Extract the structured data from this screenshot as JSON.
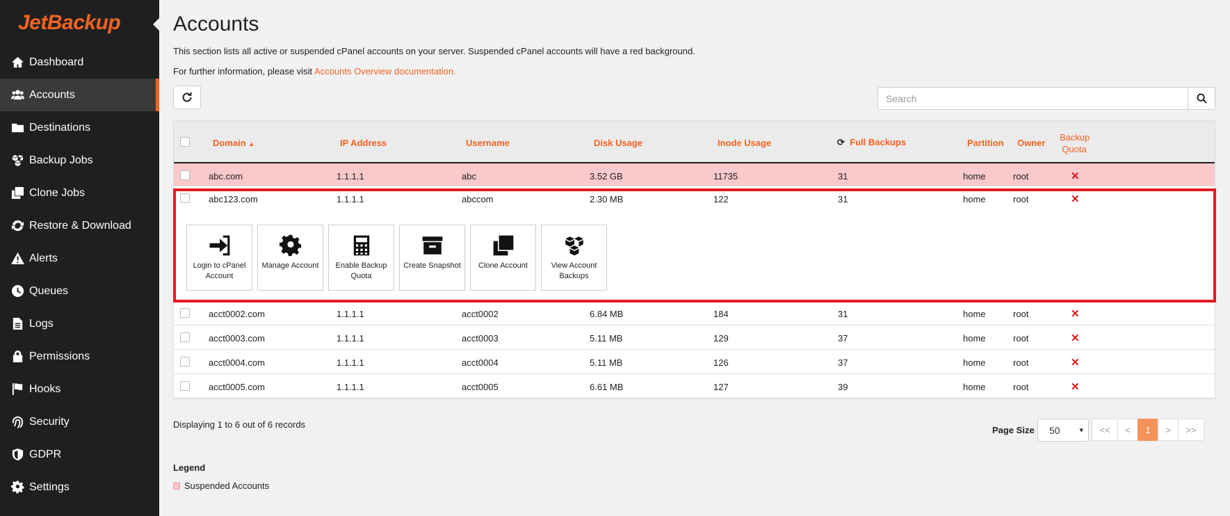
{
  "app": {
    "logo_text": "JetBackup"
  },
  "sidebar": {
    "items": [
      {
        "label": "Dashboard",
        "icon": "home-icon"
      },
      {
        "label": "Accounts",
        "icon": "users-icon",
        "active": true
      },
      {
        "label": "Destinations",
        "icon": "folder-icon"
      },
      {
        "label": "Backup Jobs",
        "icon": "cubes-icon"
      },
      {
        "label": "Clone Jobs",
        "icon": "clone-icon"
      },
      {
        "label": "Restore & Download",
        "icon": "sync-icon"
      },
      {
        "label": "Alerts",
        "icon": "warning-icon"
      },
      {
        "label": "Queues",
        "icon": "clock-icon"
      },
      {
        "label": "Logs",
        "icon": "file-icon"
      },
      {
        "label": "Permissions",
        "icon": "lock-icon"
      },
      {
        "label": "Hooks",
        "icon": "flag-icon"
      },
      {
        "label": "Security",
        "icon": "fingerprint-icon"
      },
      {
        "label": "GDPR",
        "icon": "shield-icon"
      },
      {
        "label": "Settings",
        "icon": "gear-icon"
      }
    ]
  },
  "page": {
    "title": "Accounts",
    "description": "This section lists all active or suspended cPanel accounts on your server. Suspended cPanel accounts will have a red background.",
    "further_info_prefix": "For further information, please visit ",
    "further_info_link": "Accounts Overview documentation."
  },
  "search": {
    "placeholder": "Search"
  },
  "table": {
    "headers": {
      "domain": "Domain",
      "ip": "IP Address",
      "username": "Username",
      "disk": "Disk Usage",
      "inode": "Inode Usage",
      "full_backups": "Full Backups",
      "partition": "Partition",
      "owner": "Owner",
      "quota_line1": "Backup",
      "quota_line2": "Quota"
    },
    "rows": [
      {
        "domain": "abc.com",
        "ip": "1.1.1.1",
        "username": "abc",
        "disk": "3.52 GB",
        "inode": "11735",
        "full_backups": "31",
        "partition": "home",
        "owner": "root",
        "quota": "✕"
      },
      {
        "domain": "abc123.com",
        "ip": "1.1.1.1",
        "username": "abccom",
        "disk": "2.30 MB",
        "inode": "122",
        "full_backups": "31",
        "partition": "home",
        "owner": "root",
        "quota": "✕"
      },
      {
        "domain": "acct0002.com",
        "ip": "1.1.1.1",
        "username": "acct0002",
        "disk": "6.84 MB",
        "inode": "184",
        "full_backups": "31",
        "partition": "home",
        "owner": "root",
        "quota": "✕"
      },
      {
        "domain": "acct0003.com",
        "ip": "1.1.1.1",
        "username": "acct0003",
        "disk": "5.11 MB",
        "inode": "129",
        "full_backups": "37",
        "partition": "home",
        "owner": "root",
        "quota": "✕"
      },
      {
        "domain": "acct0004.com",
        "ip": "1.1.1.1",
        "username": "acct0004",
        "disk": "5.11 MB",
        "inode": "126",
        "full_backups": "37",
        "partition": "home",
        "owner": "root",
        "quota": "✕"
      },
      {
        "domain": "acct0005.com",
        "ip": "1.1.1.1",
        "username": "acct0005",
        "disk": "6.61 MB",
        "inode": "127",
        "full_backups": "39",
        "partition": "home",
        "owner": "root",
        "quota": "✕"
      }
    ]
  },
  "actions": [
    {
      "label": "Login to cPanel Account",
      "icon": "login-icon"
    },
    {
      "label": "Manage Account",
      "icon": "gear-icon"
    },
    {
      "label": "Enable Backup Quota",
      "icon": "calculator-icon"
    },
    {
      "label": "Create Snapshot",
      "icon": "archive-icon"
    },
    {
      "label": "Clone Account",
      "icon": "clone-icon"
    },
    {
      "label": "View Account Backups",
      "icon": "cubes-icon"
    }
  ],
  "footer": {
    "records": "Displaying 1 to 6 out of 6 records",
    "page_size_label": "Page Size",
    "page_size_value": "50",
    "pager": [
      "<<",
      "<",
      "1",
      ">",
      ">>"
    ]
  },
  "legend": {
    "title": "Legend",
    "suspended": "Suspended Accounts"
  },
  "colors": {
    "accent": "#f26322",
    "suspended": "#f9c9cb",
    "highlight": "#e31b23"
  }
}
